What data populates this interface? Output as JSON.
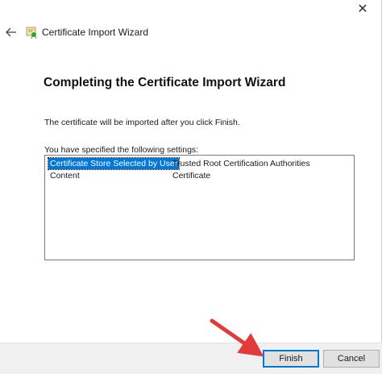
{
  "window": {
    "close_glyph": "✕",
    "title": "Certificate Import Wizard"
  },
  "main": {
    "heading": "Completing the Certificate Import Wizard",
    "info_text": "The certificate will be imported after you click Finish.",
    "settings_label": "You have specified the following settings:",
    "settings": [
      {
        "key": "Certificate Store Selected by User",
        "value": "Trusted Root Certification Authorities",
        "selected": true
      },
      {
        "key": "Content",
        "value": "Certificate",
        "selected": false
      }
    ]
  },
  "footer": {
    "finish_label": "Finish",
    "cancel_label": "Cancel"
  },
  "annotation": {
    "arrow_color": "#e03a3a",
    "points_to": "finish-button"
  }
}
